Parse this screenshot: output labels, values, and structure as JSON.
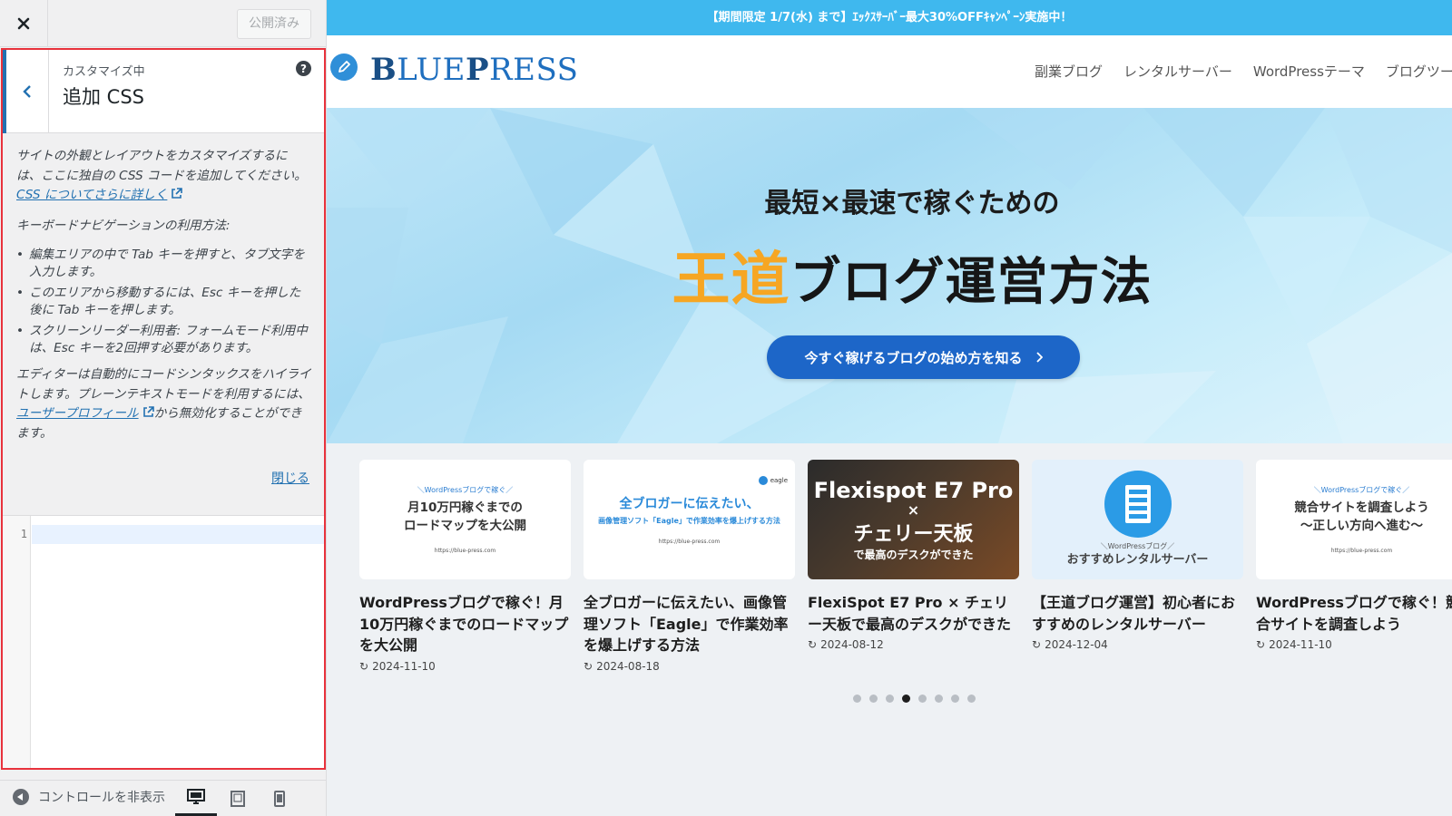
{
  "customizer": {
    "publish_label": "公開済み",
    "crumb": "カスタマイズ中",
    "section_title": "追加 CSS",
    "help_label": "?",
    "description_1": "サイトの外観とレイアウトをカスタマイズするには、ここに独自の CSS コードを追加してください。",
    "learn_more_link": "CSS についてさらに詳しく",
    "keyboard_heading": "キーボードナビゲーションの利用方法:",
    "keyboard_items": [
      "編集エリアの中で Tab キーを押すと、タブ文字を入力します。",
      "このエリアから移動するには、Esc キーを押した後に Tab キーを押します。",
      "スクリーンリーダー利用者: フォームモード利用中は、Esc キーを2回押す必要があります。"
    ],
    "editor_note_pre": "エディターは自動的にコードシンタックスをハイライトします。プレーンテキストモードを利用するには、",
    "user_profile_link": "ユーザープロフィール",
    "editor_note_post": "から無効化することができます。",
    "close_link": "閉じる",
    "line_number": "1",
    "collapse_label": "コントロールを非表示"
  },
  "site": {
    "announcement": "【期間限定 1/7(水) まで】ｴｯｸｽｻｰﾊﾞｰ最大30%OFFｷｬﾝﾍﾟｰﾝ実施中！",
    "logo_first": "B",
    "logo_mid": "LUE",
    "logo_second": "P",
    "logo_end": "RESS",
    "nav": [
      "副業ブログ",
      "レンタルサーバー",
      "WordPressテーマ",
      "ブログツール"
    ],
    "hero_sub": "最短×最速で稼ぐための",
    "hero_accent": "王道",
    "hero_main": "ブログ運営方法",
    "cta_label": "今すぐ稼げるブログの始め方を知る",
    "cards": [
      {
        "thumb_kicker": "＼WordPressブログで稼ぐ／",
        "thumb_line1": "月10万円稼ぐまでの",
        "thumb_line2": "ロードマップを大公開",
        "thumb_url": "https://blue-press.com",
        "title": "WordPressブログで稼ぐ！月10万円稼ぐまでのロードマップを大公開",
        "date": "2024-11-10"
      },
      {
        "thumb_brand": "eagle",
        "thumb_line1": "全ブロガーに伝えたい、",
        "thumb_line2": "画像管理ソフト「Eagle」で作業効率を爆上げする方法",
        "thumb_url": "https://blue-press.com",
        "title": "全ブロガーに伝えたい、画像管理ソフト「Eagle」で作業効率を爆上げする方法",
        "date": "2024-08-18"
      },
      {
        "thumb_line1": "Flexispot E7 Pro",
        "thumb_line2": "×",
        "thumb_line3": "チェリー天板",
        "thumb_line4": "で最高のデスクができた",
        "title": "FlexiSpot E7 Pro × チェリー天板で最高のデスクができた",
        "date": "2024-08-12"
      },
      {
        "thumb_kicker": "＼WordPressブログ／",
        "thumb_line1": "おすすめレンタルサーバー",
        "title": "【王道ブログ運営】初心者におすすめのレンタルサーバー",
        "date": "2024-12-04"
      },
      {
        "thumb_kicker": "＼WordPressブログで稼ぐ／",
        "thumb_line1": "競合サイトを調査しよう",
        "thumb_line2": "〜正しい方向へ進む〜",
        "thumb_url": "https://blue-press.com",
        "title": "WordPressブログで稼ぐ！競合サイトを調査しよう",
        "date": "2024-11-10"
      }
    ],
    "slider": {
      "total": 8,
      "active_index": 3
    }
  },
  "colors": {
    "accent": "#2271b1",
    "highlight_frame": "#e8323c",
    "announce_bg": "#3fb8ee",
    "cta_bg": "#1d66c8",
    "hero_accent": "#f6a623"
  }
}
